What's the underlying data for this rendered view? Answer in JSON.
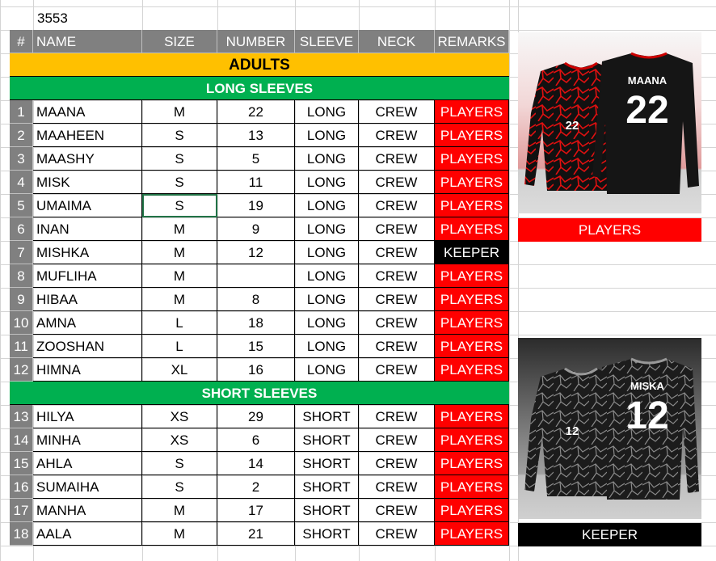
{
  "cell_a1": "3553",
  "headers": {
    "num": "#",
    "name": "NAME",
    "size": "SIZE",
    "number": "NUMBER",
    "sleeve": "SLEEVE",
    "neck": "NECK",
    "remarks": "REMARKS"
  },
  "section_title": "ADULTS",
  "long_sleeves_title": "LONG SLEEVES",
  "short_sleeves_title": "SHORT SLEEVES",
  "long_rows": [
    {
      "n": "1",
      "name": "MAANA",
      "size": "M",
      "number": "22",
      "sleeve": "LONG",
      "neck": "CREW",
      "remarks": "PLAYERS"
    },
    {
      "n": "2",
      "name": "MAAHEEN",
      "size": "S",
      "number": "13",
      "sleeve": "LONG",
      "neck": "CREW",
      "remarks": "PLAYERS"
    },
    {
      "n": "3",
      "name": "MAASHY",
      "size": "S",
      "number": "5",
      "sleeve": "LONG",
      "neck": "CREW",
      "remarks": "PLAYERS"
    },
    {
      "n": "4",
      "name": "MISK",
      "size": "S",
      "number": "11",
      "sleeve": "LONG",
      "neck": "CREW",
      "remarks": "PLAYERS"
    },
    {
      "n": "5",
      "name": "UMAIMA",
      "size": "S",
      "number": "19",
      "sleeve": "LONG",
      "neck": "CREW",
      "remarks": "PLAYERS"
    },
    {
      "n": "6",
      "name": "INAN",
      "size": "M",
      "number": "9",
      "sleeve": "LONG",
      "neck": "CREW",
      "remarks": "PLAYERS"
    },
    {
      "n": "7",
      "name": "MISHKA",
      "size": "M",
      "number": "12",
      "sleeve": "LONG",
      "neck": "CREW",
      "remarks": "KEEPER"
    },
    {
      "n": "8",
      "name": "MUFLIHA",
      "size": "M",
      "number": "",
      "sleeve": "LONG",
      "neck": "CREW",
      "remarks": "PLAYERS"
    },
    {
      "n": "9",
      "name": "HIBAA",
      "size": "M",
      "number": "8",
      "sleeve": "LONG",
      "neck": "CREW",
      "remarks": "PLAYERS"
    },
    {
      "n": "10",
      "name": "AMNA",
      "size": "L",
      "number": "18",
      "sleeve": "LONG",
      "neck": "CREW",
      "remarks": "PLAYERS"
    },
    {
      "n": "11",
      "name": "ZOOSHAN",
      "size": "L",
      "number": "15",
      "sleeve": "LONG",
      "neck": "CREW",
      "remarks": "PLAYERS"
    },
    {
      "n": "12",
      "name": "HIMNA",
      "size": "XL",
      "number": "16",
      "sleeve": "LONG",
      "neck": "CREW",
      "remarks": "PLAYERS"
    }
  ],
  "short_rows": [
    {
      "n": "13",
      "name": "HILYA",
      "size": "XS",
      "number": "29",
      "sleeve": "SHORT",
      "neck": "CREW",
      "remarks": "PLAYERS"
    },
    {
      "n": "14",
      "name": "MINHA",
      "size": "XS",
      "number": "6",
      "sleeve": "SHORT",
      "neck": "CREW",
      "remarks": "PLAYERS"
    },
    {
      "n": "15",
      "name": "AHLA",
      "size": "S",
      "number": "14",
      "sleeve": "SHORT",
      "neck": "CREW",
      "remarks": "PLAYERS"
    },
    {
      "n": "16",
      "name": "SUMAIHA",
      "size": "S",
      "number": "2",
      "sleeve": "SHORT",
      "neck": "CREW",
      "remarks": "PLAYERS"
    },
    {
      "n": "17",
      "name": "MANHA",
      "size": "M",
      "number": "17",
      "sleeve": "SHORT",
      "neck": "CREW",
      "remarks": "PLAYERS"
    },
    {
      "n": "18",
      "name": "AALA",
      "size": "M",
      "number": "21",
      "sleeve": "SHORT",
      "neck": "CREW",
      "remarks": "PLAYERS"
    }
  ],
  "jerseys": {
    "players": {
      "back_name": "MAANA",
      "back_number": "22",
      "front_number": "22",
      "caption": "PLAYERS",
      "color": "#c40000"
    },
    "keeper": {
      "back_name": "MISKA",
      "back_number": "12",
      "front_number": "12",
      "caption": "KEEPER",
      "color": "#1a1a1a"
    }
  },
  "colors": {
    "players_red": "#ff0000",
    "keeper_black": "#000000",
    "adults_band": "#ffc000",
    "sleeve_band": "#00b050",
    "header_gray": "#808080"
  }
}
